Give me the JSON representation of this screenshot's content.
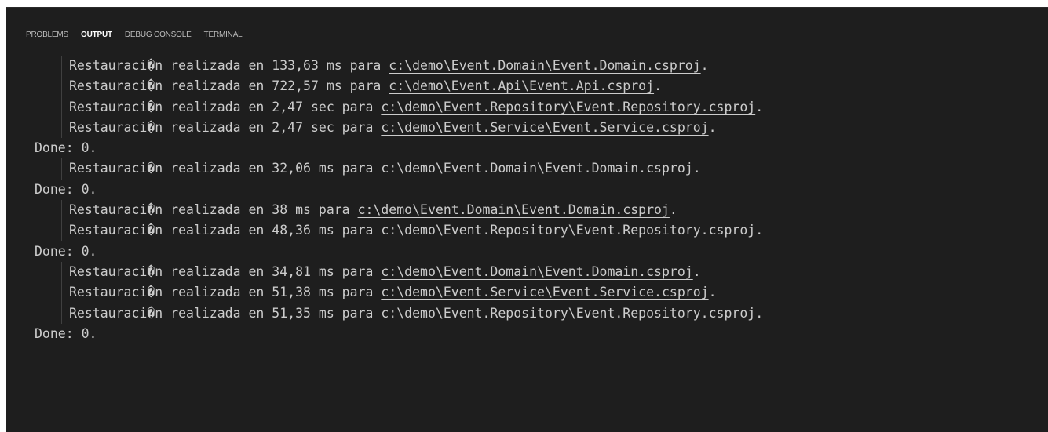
{
  "tabs": [
    {
      "label": "PROBLEMS",
      "active": false
    },
    {
      "label": "OUTPUT",
      "active": true
    },
    {
      "label": "DEBUG CONSOLE",
      "active": false
    },
    {
      "label": "TERMINAL",
      "active": false
    }
  ],
  "lines": [
    {
      "indent": true,
      "prefix": "Restauraci�n realizada en 133,63 ms para ",
      "path": "c:\\demo\\Event.Domain\\Event.Domain.csproj",
      "suffix": "."
    },
    {
      "indent": true,
      "prefix": "Restauraci�n realizada en 722,57 ms para ",
      "path": "c:\\demo\\Event.Api\\Event.Api.csproj",
      "suffix": "."
    },
    {
      "indent": true,
      "prefix": "Restauraci�n realizada en 2,47 sec para ",
      "path": "c:\\demo\\Event.Repository\\Event.Repository.csproj",
      "suffix": "."
    },
    {
      "indent": true,
      "prefix": "Restauraci�n realizada en 2,47 sec para ",
      "path": "c:\\demo\\Event.Service\\Event.Service.csproj",
      "suffix": "."
    },
    {
      "indent": false,
      "prefix": "Done: 0.",
      "path": "",
      "suffix": ""
    },
    {
      "indent": true,
      "prefix": "Restauraci�n realizada en 32,06 ms para ",
      "path": "c:\\demo\\Event.Domain\\Event.Domain.csproj",
      "suffix": "."
    },
    {
      "indent": false,
      "prefix": "Done: 0.",
      "path": "",
      "suffix": ""
    },
    {
      "indent": true,
      "prefix": "Restauraci�n realizada en 38 ms para ",
      "path": "c:\\demo\\Event.Domain\\Event.Domain.csproj",
      "suffix": "."
    },
    {
      "indent": true,
      "prefix": "Restauraci�n realizada en 48,36 ms para ",
      "path": "c:\\demo\\Event.Repository\\Event.Repository.csproj",
      "suffix": "."
    },
    {
      "indent": false,
      "prefix": "Done: 0.",
      "path": "",
      "suffix": ""
    },
    {
      "indent": true,
      "prefix": "Restauraci�n realizada en 34,81 ms para ",
      "path": "c:\\demo\\Event.Domain\\Event.Domain.csproj",
      "suffix": "."
    },
    {
      "indent": true,
      "prefix": "Restauraci�n realizada en 51,38 ms para ",
      "path": "c:\\demo\\Event.Service\\Event.Service.csproj",
      "suffix": "."
    },
    {
      "indent": true,
      "prefix": "Restauraci�n realizada en 51,35 ms para ",
      "path": "c:\\demo\\Event.Repository\\Event.Repository.csproj",
      "suffix": "."
    },
    {
      "indent": false,
      "prefix": "Done: 0.",
      "path": "",
      "suffix": ""
    }
  ]
}
